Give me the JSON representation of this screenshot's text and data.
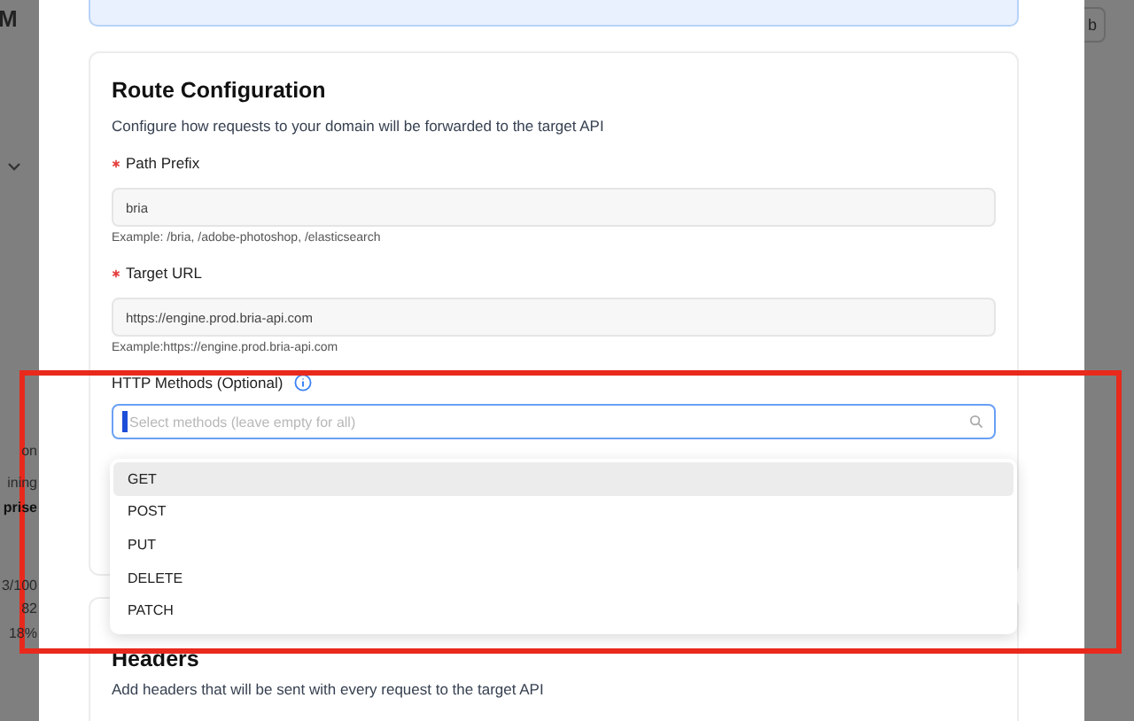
{
  "background": {
    "logo_fragment": "M",
    "button_fragment": "b",
    "side_texts": [
      {
        "text": "on",
        "kind": "plain"
      },
      {
        "text": "ining",
        "kind": "plain"
      },
      {
        "text": "prise",
        "kind": "bold"
      },
      {
        "text": "3/100",
        "kind": "plain"
      },
      {
        "text": "82",
        "kind": "plain"
      },
      {
        "text": "18%",
        "kind": "plain"
      }
    ]
  },
  "route_configuration": {
    "title": "Route Configuration",
    "description": "Configure how requests to your domain will be forwarded to the target API",
    "fields": [
      {
        "label": "Path Prefix",
        "required": true,
        "value": "bria",
        "example": "Example: /bria, /adobe-photoshop, /elasticsearch"
      },
      {
        "label": "Target URL",
        "required": true,
        "value": "https://engine.prod.bria-api.com",
        "example": "Example:https://engine.prod.bria-api.com"
      }
    ],
    "methods": {
      "label": "HTTP Methods (Optional)",
      "placeholder": "Select methods (leave empty for all)",
      "focused": true,
      "options": [
        {
          "label": "GET",
          "selected": false,
          "active": true
        },
        {
          "label": "POST",
          "selected": false,
          "active": false
        },
        {
          "label": "PUT",
          "selected": false,
          "active": false
        },
        {
          "label": "DELETE",
          "selected": false,
          "active": false
        },
        {
          "label": "PATCH",
          "selected": false,
          "active": false
        }
      ]
    }
  },
  "headers": {
    "title": "Headers",
    "description": "Add headers that will be sent with every request to the target API"
  },
  "highlight": {
    "color": "#e8291c"
  }
}
